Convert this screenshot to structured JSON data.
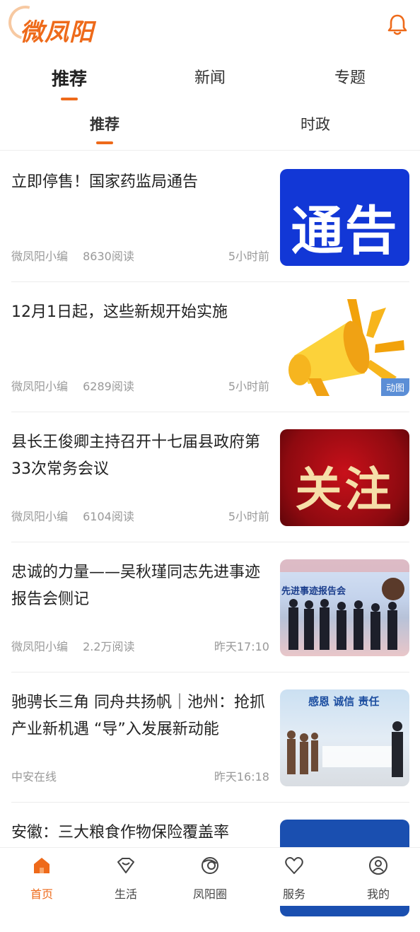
{
  "app": {
    "logo_text": "微凤阳"
  },
  "colors": {
    "accent": "#ee6a1a",
    "notice_blue": "#1237d6",
    "badge_blue": "#5b8ed6"
  },
  "header": {
    "bell_icon": "bell-icon"
  },
  "top_tabs": [
    {
      "label": "推荐",
      "active": true
    },
    {
      "label": "新闻",
      "active": false
    },
    {
      "label": "专题",
      "active": false
    }
  ],
  "sub_tabs": [
    {
      "label": "推荐",
      "active": true
    },
    {
      "label": "时政",
      "active": false
    }
  ],
  "articles": [
    {
      "title": "立即停售！国家药监局通告",
      "source": "微凤阳小编",
      "reads": "8630阅读",
      "time": "5小时前",
      "thumb_text": "通告"
    },
    {
      "title": "12月1日起，这些新规开始实施",
      "source": "微凤阳小编",
      "reads": "6289阅读",
      "time": "5小时前",
      "thumb_badge": "动图"
    },
    {
      "title": "县长王俊卿主持召开十七届县政府第33次常务会议",
      "source": "微凤阳小编",
      "reads": "6104阅读",
      "time": "5小时前",
      "thumb_text": "关注"
    },
    {
      "title": "忠诚的力量——吴秋瑾同志先进事迹报告会侧记",
      "source": "微凤阳小编",
      "reads": "2.2万阅读",
      "time": "昨天17:10",
      "thumb_text": "先进事迹报告会"
    },
    {
      "title": "驰骋长三角 同舟共扬帆｜池州：抢抓产业新机遇 “导”入发展新动能",
      "source": "中安在线",
      "reads": "",
      "time": "昨天16:18",
      "thumb_text": "感恩 诚信 责任"
    },
    {
      "title": "安徽：三大粮食作物保险覆盖率",
      "source": "",
      "reads": "",
      "time": ""
    }
  ],
  "bottom_nav": [
    {
      "label": "首页",
      "icon": "home-icon",
      "active": true
    },
    {
      "label": "生活",
      "icon": "heart-diamond-icon",
      "active": false
    },
    {
      "label": "凤阳圈",
      "icon": "circle-swirl-icon",
      "active": false
    },
    {
      "label": "服务",
      "icon": "heart-icon",
      "active": false
    },
    {
      "label": "我的",
      "icon": "user-icon",
      "active": false
    }
  ]
}
